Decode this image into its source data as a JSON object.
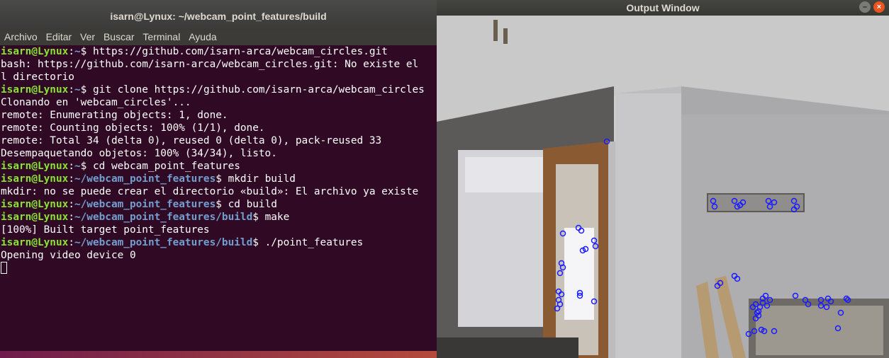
{
  "terminal": {
    "title": "isarn@Lynux: ~/webcam_point_features/build",
    "menu": [
      "Archivo",
      "Editar",
      "Ver",
      "Buscar",
      "Terminal",
      "Ayuda"
    ],
    "lines": [
      {
        "user": "isarn@Lynux",
        "path": "~",
        "sym": "$",
        "cmd": " https://github.com/isarn-arca/webcam_circles.git"
      },
      {
        "text": "bash: https://github.com/isarn-arca/webcam_circles.git: No existe el"
      },
      {
        "text": "l directorio"
      },
      {
        "user": "isarn@Lynux",
        "path": "~",
        "sym": "$",
        "cmd": " git clone https://github.com/isarn-arca/webcam_circles"
      },
      {
        "text": "Clonando en 'webcam_circles'..."
      },
      {
        "text": "remote: Enumerating objects: 1, done."
      },
      {
        "text": "remote: Counting objects: 100% (1/1), done."
      },
      {
        "text": "remote: Total 34 (delta 0), reused 0 (delta 0), pack-reused 33"
      },
      {
        "text": "Desempaquetando objetos: 100% (34/34), listo."
      },
      {
        "user": "isarn@Lynux",
        "path": "~",
        "sym": "$",
        "cmd": " cd webcam_point_features"
      },
      {
        "user": "isarn@Lynux",
        "path": "~/webcam_point_features",
        "sym": "$",
        "cmd": " mkdir build"
      },
      {
        "text": "mkdir: no se puede crear el directorio «build»: El archivo ya existe"
      },
      {
        "user": "isarn@Lynux",
        "path": "~/webcam_point_features",
        "sym": "$",
        "cmd": " cd build"
      },
      {
        "user": "isarn@Lynux",
        "path": "~/webcam_point_features/build",
        "sym": "$",
        "cmd": " make"
      },
      {
        "text": "[100%] Built target point_features"
      },
      {
        "user": "isarn@Lynux",
        "path": "~/webcam_point_features/build",
        "sym": "$",
        "cmd": " ./point_features"
      },
      {
        "text": "Opening video device 0"
      }
    ]
  },
  "output_window": {
    "title": "Output Window",
    "minimize_icon": "minimize-icon",
    "close_icon": "close-icon",
    "minimize_glyph": "–",
    "close_glyph": "×",
    "feature_color": "#1a1aff"
  }
}
